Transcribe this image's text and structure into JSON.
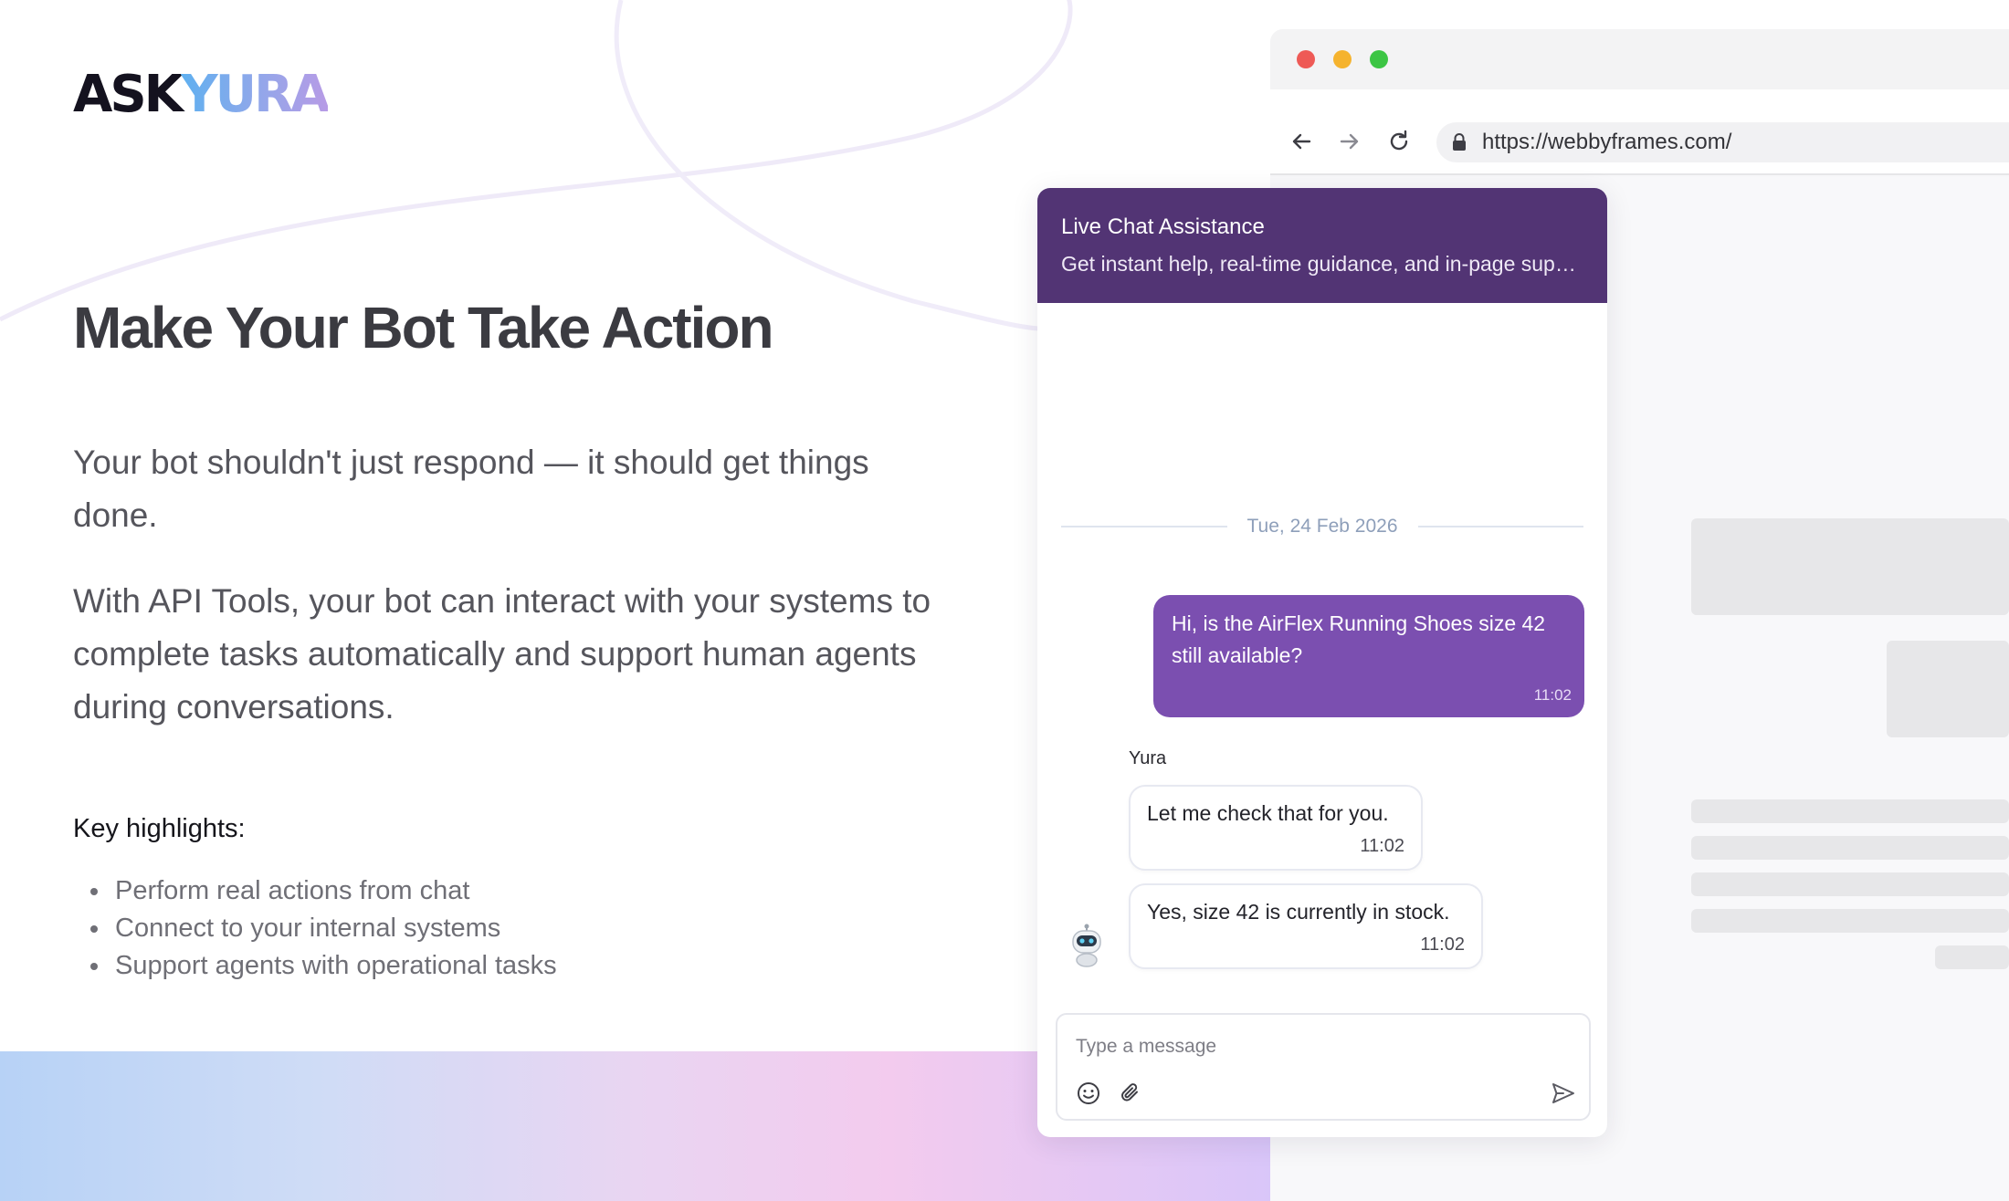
{
  "brand": {
    "logo_part1": "ASK",
    "logo_part2": "YURA",
    "logo_gradient": [
      "#5fb0f0",
      "#b79be6"
    ]
  },
  "hero": {
    "headline": "Make Your Bot Take Action",
    "paragraph_1": "Your bot shouldn't just respond — it should get things done.",
    "paragraph_2": "With API Tools, your bot can interact with your systems to complete tasks automatically and support human agents during conversations.",
    "highlights_title": "Key highlights:",
    "highlights": [
      "Perform real actions from chat",
      "Connect to your internal systems",
      "Support agents with operational tasks"
    ]
  },
  "browser": {
    "url": "https://webbyframes.com/",
    "traffic_colors": [
      "#ee5a56",
      "#f5b32e",
      "#3cc544"
    ]
  },
  "chat": {
    "header_color": "#523474",
    "title": "Live Chat Assistance",
    "subtitle": "Get instant help, real-time guidance, and in-page support from our assistant.",
    "date": "Tue, 24 Feb 2026",
    "messages": [
      {
        "from": "user",
        "text": "Hi, is the AirFlex Running Shoes size 42 still available?",
        "time": "11:02"
      },
      {
        "from": "bot",
        "text": "Let me check that for you.",
        "time": "11:02"
      },
      {
        "from": "bot",
        "text": "Yes, size 42 is currently in stock.",
        "time": "11:02"
      }
    ],
    "bot_name": "Yura",
    "user_bubble_color": "#7b4fb0",
    "composer": {
      "placeholder": "Type a message"
    }
  }
}
